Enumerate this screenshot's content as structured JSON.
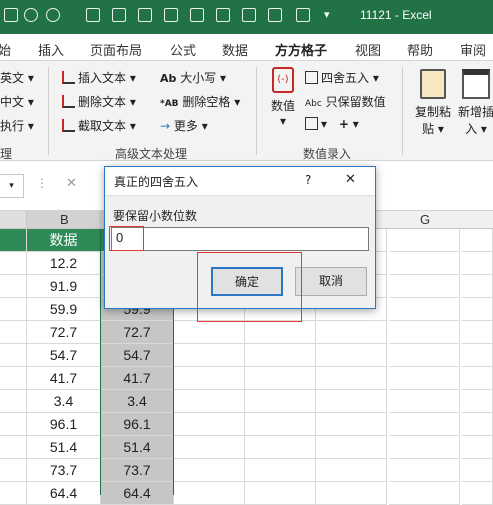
{
  "window": {
    "title": "11121  -  Excel"
  },
  "tabs": [
    {
      "label": "始",
      "active": false
    },
    {
      "label": "插入",
      "active": false
    },
    {
      "label": "页面布局",
      "active": false
    },
    {
      "label": "公式",
      "active": false
    },
    {
      "label": "数据",
      "active": false
    },
    {
      "label": "方方格子",
      "active": true
    },
    {
      "label": "视图",
      "active": false
    },
    {
      "label": "帮助",
      "active": false
    },
    {
      "label": "审阅",
      "active": false
    }
  ],
  "ribbon": {
    "left_items": [
      "英文",
      "中文",
      "执行"
    ],
    "left_group": "理",
    "text_col1": [
      "插入文本",
      "删除文本",
      "截取文本"
    ],
    "text_col2": [
      "大小写",
      "删除空格",
      "更多"
    ],
    "text_group": "高级文本处理",
    "value_btn": "数值",
    "value_items": [
      "四舍五入",
      "只保留数值"
    ],
    "value_group": "数值录入",
    "copy_btn": [
      "复制粘",
      "贴"
    ],
    "new_btn": [
      "新增插",
      "入"
    ]
  },
  "columns": [
    "B",
    "G"
  ],
  "header_cell": "数据",
  "col_b": [
    "12.2",
    "91.9",
    "59.9",
    "72.7",
    "54.7",
    "41.7",
    "3.4",
    "96.1",
    "51.4",
    "73.7",
    "64.4"
  ],
  "col_c": [
    "",
    "",
    "59.9",
    "72.7",
    "54.7",
    "41.7",
    "3.4",
    "96.1",
    "51.4",
    "73.7",
    "64.4"
  ],
  "dialog": {
    "title": "真正的四舍五入",
    "help": "?",
    "close": "✕",
    "prompt": "要保留小数位数",
    "value": "0",
    "ok": "确定",
    "cancel": "取消"
  },
  "colors": {
    "brand": "#217346",
    "accent": "#2b78c5",
    "highlight_red": "#e53935",
    "selection": "#c6c6c6"
  }
}
